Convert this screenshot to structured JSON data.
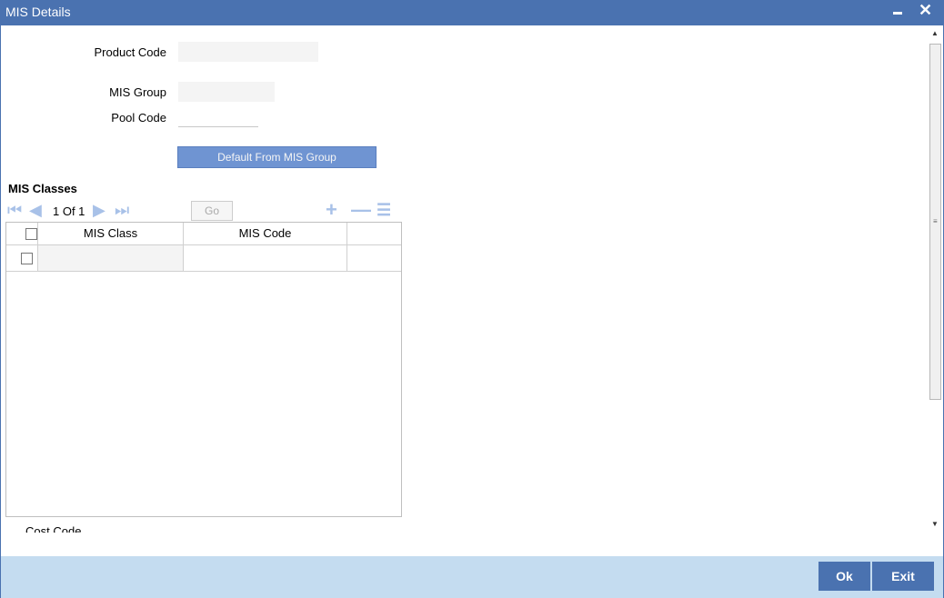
{
  "window": {
    "title": "MIS Details"
  },
  "form": {
    "product_code_label": "Product Code",
    "product_code_value": "",
    "mis_group_label": "MIS Group",
    "mis_group_value": "",
    "pool_code_label": "Pool Code",
    "pool_code_value": "",
    "default_button_label": "Default From MIS Group"
  },
  "mis_classes": {
    "title": "MIS Classes",
    "pager": {
      "text": "1 Of 1",
      "go_label": "Go",
      "page_input": ""
    },
    "columns": [
      "MIS Class",
      "MIS Code"
    ],
    "rows": [
      {
        "mis_class": "",
        "mis_code": ""
      }
    ]
  },
  "cost_code_label": "Cost Code",
  "footer": {
    "ok_label": "Ok",
    "exit_label": "Exit"
  },
  "colors": {
    "titlebar": "#4a72b0",
    "footer": "#c4dcf0",
    "button": "#4a72b0",
    "default_button": "#6f94d2"
  }
}
